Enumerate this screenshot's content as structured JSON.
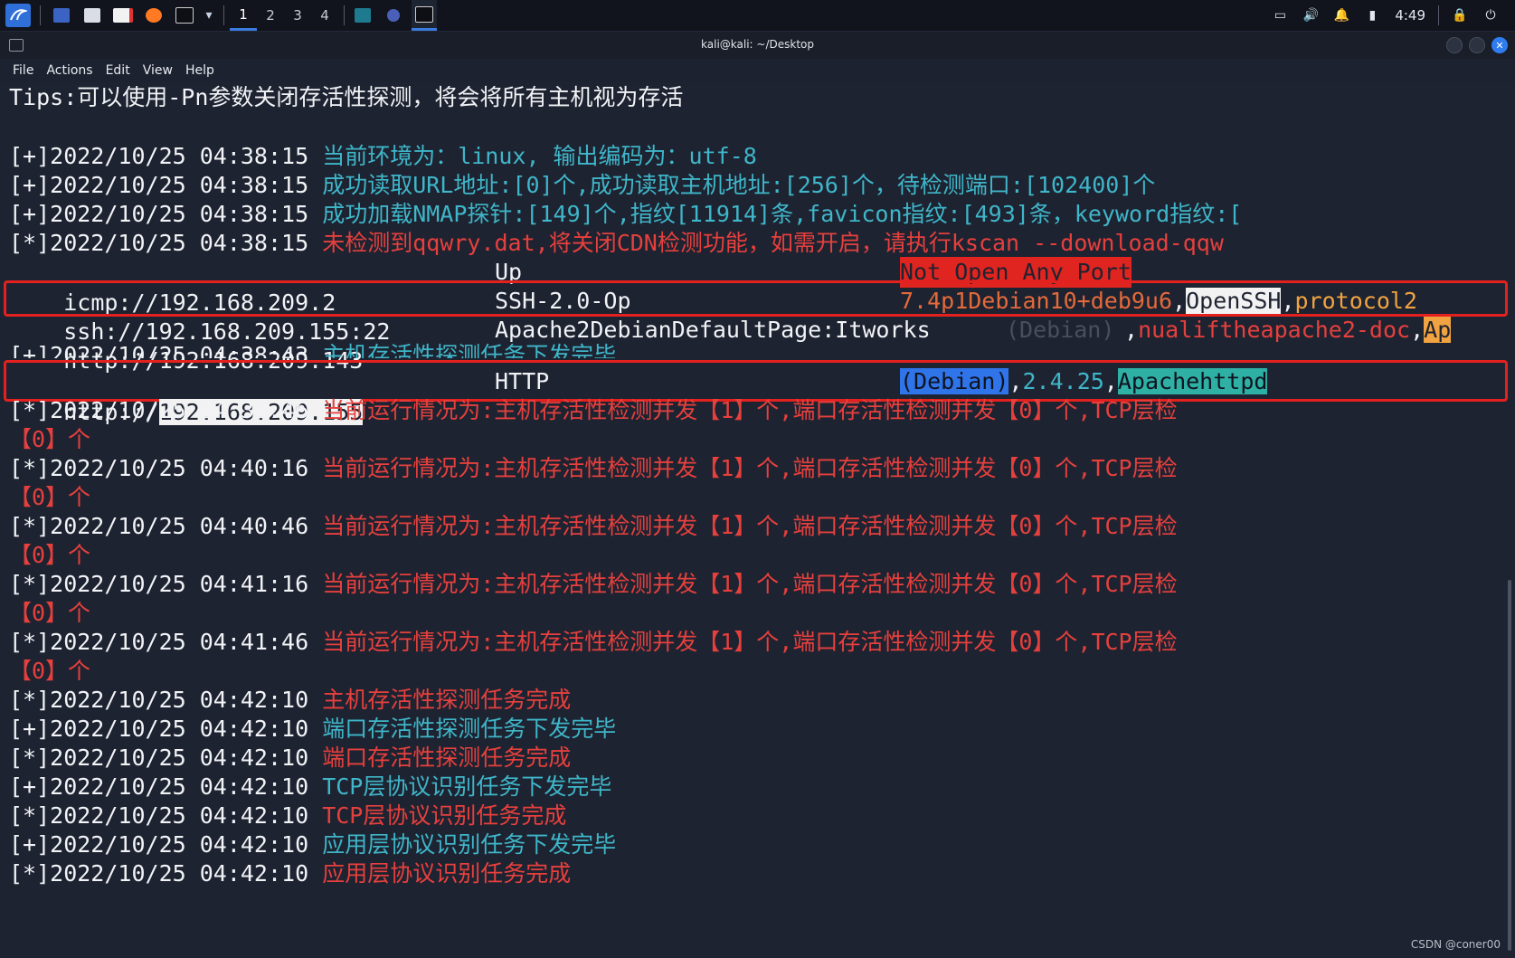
{
  "taskbar": {
    "workspaces": [
      "1",
      "2",
      "3",
      "4"
    ],
    "clock": "4:49"
  },
  "window": {
    "title": "kali@kali: ~/Desktop",
    "menu": [
      "File",
      "Actions",
      "Edit",
      "View",
      "Help"
    ]
  },
  "terminal": {
    "tips": "Tips:可以使用-Pn参数关闭存活性探测，将会将所有主机视为存活",
    "log_lines": [
      {
        "prefix": "[+]2022/10/25 04:38:15 ",
        "msg": "当前环境为：linux, 输出编码为：utf-8",
        "color": "cyan"
      },
      {
        "prefix": "[+]2022/10/25 04:38:15 ",
        "msg": "成功读取URL地址:[0]个,成功读取主机地址:[256]个，待检测端口:[102400]个",
        "color": "cyan"
      },
      {
        "prefix": "[+]2022/10/25 04:38:15 ",
        "msg": "成功加载NMAP探针:[149]个,指纹[11914]条,favicon指纹:[493]条，keyword指纹:[",
        "color": "cyan"
      },
      {
        "prefix": "[*]2022/10/25 04:38:15 ",
        "msg": "未检测到qqwry.dat,将关闭CDN检测功能，如需开启，请执行kscan --download-qqw",
        "color": "red"
      }
    ],
    "icmp": {
      "url": "icmp://192.168.209.2",
      "status": "Up",
      "note": "Not Open Any Port"
    },
    "ssh": {
      "url": "ssh://192.168.209.155:22",
      "banner": "SSH-2.0-Op",
      "version": "7.4p1Debian10+deb9u6",
      "sep1": ",",
      "product": "OpenSSH",
      "sep2": ",",
      "proto": "protocol2"
    },
    "http143": {
      "url": "http://192.168.209.143",
      "title": "Apache2DebianDefaultPage:Itworks",
      "ghost": "(Debian)",
      "sep1": ",",
      "info": "nualiftheapache2-doc",
      "sep2": ",",
      "tail": "Ap"
    },
    "task_line": {
      "prefix": "[+]2022/10/25 04:38:43 ",
      "msg": "主机存活性探测任务下发完毕"
    },
    "http155": {
      "scheme": "http://",
      "host": "192.168.209.155",
      "proto": "HTTP",
      "os": "(Debian)",
      "sep1": ",",
      "version": "2.4.25",
      "sep2": ",",
      "server": "Apachehttpd"
    },
    "status_lines": [
      {
        "prefix": "[*]2022/10/25 04:39:46 ",
        "msg": "当前运行情况为:主机存活性检测并发【1】个,端口存活性检测并发【0】个,TCP层检",
        "cont": "【0】个"
      },
      {
        "prefix": "[*]2022/10/25 04:40:16 ",
        "msg": "当前运行情况为:主机存活性检测并发【1】个,端口存活性检测并发【0】个,TCP层检",
        "cont": "【0】个"
      },
      {
        "prefix": "[*]2022/10/25 04:40:46 ",
        "msg": "当前运行情况为:主机存活性检测并发【1】个,端口存活性检测并发【0】个,TCP层检",
        "cont": "【0】个"
      },
      {
        "prefix": "[*]2022/10/25 04:41:16 ",
        "msg": "当前运行情况为:主机存活性检测并发【1】个,端口存活性检测并发【0】个,TCP层检",
        "cont": "【0】个"
      },
      {
        "prefix": "[*]2022/10/25 04:41:46 ",
        "msg": "当前运行情况为:主机存活性检测并发【1】个,端口存活性检测并发【0】个,TCP层检",
        "cont": "【0】个"
      }
    ],
    "final_lines": [
      {
        "prefix": "[*]2022/10/25 04:42:10 ",
        "msg": "主机存活性探测任务完成",
        "color": "red"
      },
      {
        "prefix": "[+]2022/10/25 04:42:10 ",
        "msg": "端口存活性探测任务下发完毕",
        "color": "cyan"
      },
      {
        "prefix": "[*]2022/10/25 04:42:10 ",
        "msg": "端口存活性探测任务完成",
        "color": "red"
      },
      {
        "prefix": "[+]2022/10/25 04:42:10 ",
        "msg": "TCP层协议识别任务下发完毕",
        "color": "cyan"
      },
      {
        "prefix": "[*]2022/10/25 04:42:10 ",
        "msg": "TCP层协议识别任务完成",
        "color": "red"
      },
      {
        "prefix": "[+]2022/10/25 04:42:10 ",
        "msg": "应用层协议识别任务下发完毕",
        "color": "cyan"
      },
      {
        "prefix": "[*]2022/10/25 04:42:10 ",
        "msg": "应用层协议识别任务完成",
        "color": "red"
      }
    ]
  },
  "watermark": "CSDN @coner00"
}
